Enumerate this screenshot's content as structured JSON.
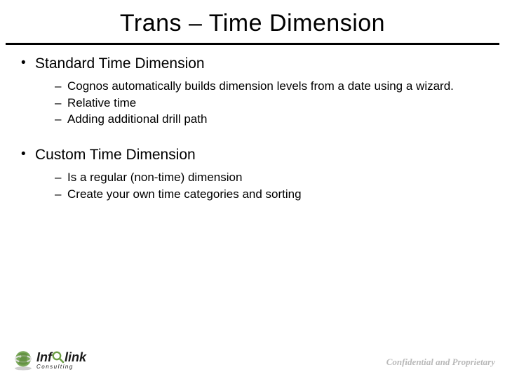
{
  "title": "Trans – Time Dimension",
  "sections": [
    {
      "heading": "Standard Time Dimension",
      "items": [
        "Cognos automatically builds dimension levels from a date using a wizard.",
        "Relative time",
        "Adding additional drill path"
      ]
    },
    {
      "heading": "Custom Time Dimension",
      "items": [
        "Is a regular (non-time) dimension",
        "Create your own time categories and sorting"
      ]
    }
  ],
  "footer": {
    "logo_name_a": "Inf",
    "logo_name_b": "link",
    "logo_sub": "Consulting",
    "confidential": "Confidential and Proprietary"
  }
}
